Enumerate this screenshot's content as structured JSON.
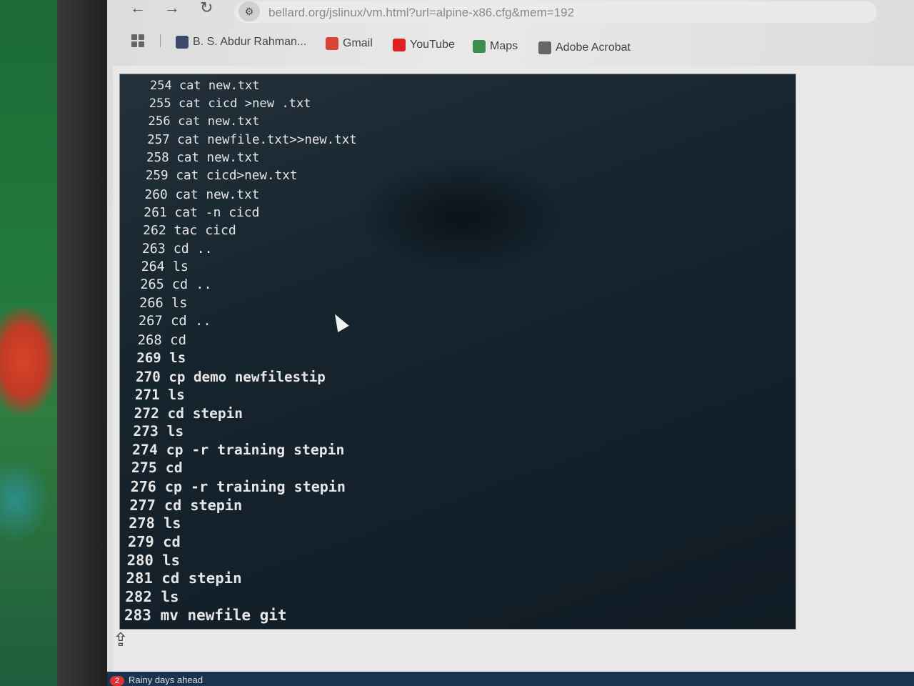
{
  "browser": {
    "back": "←",
    "forward": "→",
    "reload": "↻",
    "url": "bellard.org/jslinux/vm.html?url=alpine-x86.cfg&mem=192"
  },
  "bookmarks": [
    {
      "label": "B. S. Abdur Rahman...",
      "icon": "doc-icon",
      "color": "#3b4a6b"
    },
    {
      "label": "Gmail",
      "icon": "gmail-icon",
      "color": "#d94335"
    },
    {
      "label": "YouTube",
      "icon": "youtube-icon",
      "color": "#e02020"
    },
    {
      "label": "Maps",
      "icon": "maps-icon",
      "color": "#3a8f4f"
    },
    {
      "label": "Adobe Acrobat",
      "icon": "acrobat-icon",
      "color": "#666666"
    }
  ],
  "terminal": {
    "lines": [
      "254 cat new.txt",
      "255 cat cicd >new .txt",
      "256 cat new.txt",
      "257 cat newfile.txt>>new.txt",
      "258 cat new.txt",
      "259 cat cicd>new.txt",
      "260 cat new.txt",
      "261 cat -n cicd",
      "262 tac cicd",
      "263 cd ..",
      "264 ls",
      "265 cd ..",
      "266 ls",
      "267 cd ..",
      "268 cd",
      "269 ls",
      "270 cp demo newfilestip",
      "271 ls",
      "272 cd stepin",
      "273 ls",
      "274 cp -r training stepin",
      "275 cd",
      "276 cp -r training stepin",
      "277 cd stepin",
      "278 ls",
      "279 cd",
      "280 ls",
      "281 cd stepin",
      "282 ls",
      "283 mv newfile git"
    ]
  },
  "taskbar": {
    "badge": "2",
    "label": "Rainy days ahead"
  }
}
